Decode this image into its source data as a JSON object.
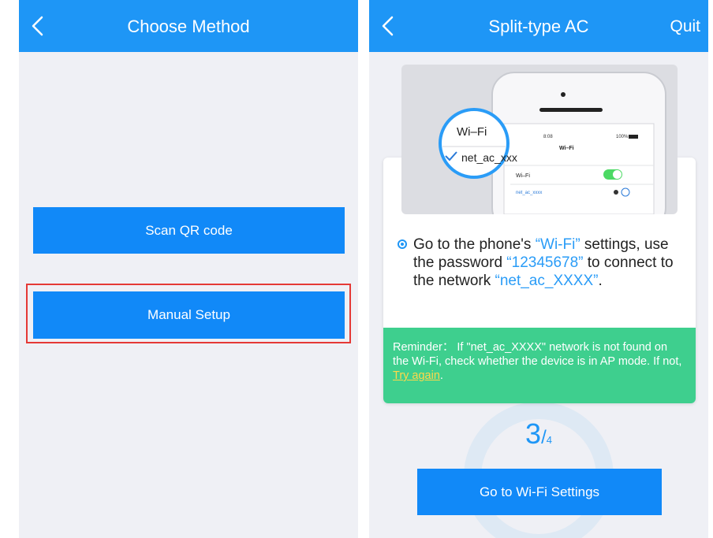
{
  "left_screen": {
    "title": "Choose Method",
    "buttons": {
      "scan_qr": "Scan QR code",
      "manual_setup": "Manual Setup"
    }
  },
  "right_screen": {
    "title": "Split-type AC",
    "quit_label": "Quit",
    "illustration": {
      "popup_wifi_label": "Wi–Fi",
      "popup_network": "net_ac_xxx",
      "phone_time": "8:08",
      "phone_battery": "100%",
      "phone_header": "Wi–Fi",
      "phone_row_wifi": "Wi–Fi",
      "phone_row_network": "net_ac_xxxx"
    },
    "instruction": {
      "part1": "Go to the phone's ",
      "wifi": "“Wi-Fi”",
      "part2": " settings, use the password ",
      "password": "“12345678”",
      "part3": " to connect to the network ",
      "network": "“net_ac_XXXX”",
      "part4": "."
    },
    "reminder": {
      "text": "Reminder： If \"net_ac_XXXX\" network is not found on the Wi-Fi, check whether the device is in AP mode. If not, ",
      "link": "Try again",
      "end": "."
    },
    "step": {
      "current": "3",
      "separator": "/",
      "total": "4"
    },
    "wifi_button": "Go to Wi-Fi Settings"
  },
  "colors": {
    "header_blue": "#1e96f6",
    "button_blue": "#1189f8",
    "reminder_green": "#3ecf8e",
    "highlight_red": "#e53935",
    "link_yellow": "#ffd84a"
  }
}
